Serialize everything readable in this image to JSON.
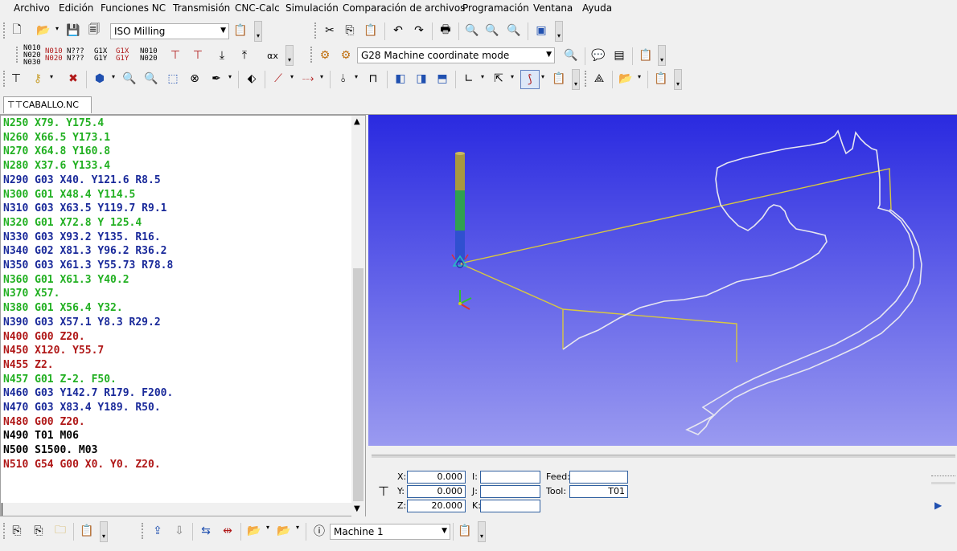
{
  "menu": [
    "Archivo",
    "Edición",
    "Funciones NC",
    "Transmisión",
    "CNC-Calc",
    "Simulación",
    "Comparación de archivos",
    "Programación",
    "Ventana",
    "Ayuda"
  ],
  "toolbar1": {
    "profile_value": "ISO Milling"
  },
  "toolbar2": {
    "mode_value": "G28 Machine coordinate mode",
    "nc_icon_labels": [
      "N010 N020 N030",
      "N010 N020",
      "N??? N???",
      "G1X G1Y",
      "G1X G1Y",
      "N010 N020"
    ]
  },
  "tab": {
    "label": "CABALLO.NC"
  },
  "code_lines": [
    {
      "text": "N250 X79. Y175.4",
      "color": "#22b022"
    },
    {
      "text": "N260 X66.5 Y173.1",
      "color": "#22b022"
    },
    {
      "text": "N270 X64.8 Y160.8",
      "color": "#22b022"
    },
    {
      "text": "N280 X37.6 Y133.4",
      "color": "#22b022"
    },
    {
      "text": "N290 G03 X40. Y121.6 R8.5",
      "color": "#1a2a9a"
    },
    {
      "text": "N300 G01 X48.4 Y114.5",
      "color": "#22b022"
    },
    {
      "text": "N310 G03 X63.5 Y119.7 R9.1",
      "color": "#1a2a9a"
    },
    {
      "text": "N320 G01 X72.8 Y 125.4",
      "color": "#22b022"
    },
    {
      "text": "N330 G03 X93.2 Y135. R16.",
      "color": "#1a2a9a"
    },
    {
      "text": "N340 G02 X81.3 Y96.2 R36.2",
      "color": "#1a2a9a"
    },
    {
      "text": "N350 G03 X61.3 Y55.73 R78.8",
      "color": "#1a2a9a"
    },
    {
      "text": "N360 G01 X61.3 Y40.2",
      "color": "#22b022"
    },
    {
      "text": "N370 X57.",
      "color": "#22b022"
    },
    {
      "text": "N380 G01 X56.4 Y32.",
      "color": "#22b022"
    },
    {
      "text": "N390 G03 X57.1 Y8.3 R29.2",
      "color": "#1a2a9a"
    },
    {
      "text": "N400 G00 Z20.",
      "color": "#b01818"
    },
    {
      "text": "N450 X120. Y55.7",
      "color": "#b01818"
    },
    {
      "text": "N455 Z2.",
      "color": "#b01818"
    },
    {
      "text": "N457 G01 Z-2. F50.",
      "color": "#22b022"
    },
    {
      "text": "N460 G03 Y142.7 R179. F200.",
      "color": "#1a2a9a"
    },
    {
      "text": "N470 G03 X83.4 Y189. R50.",
      "color": "#1a2a9a"
    },
    {
      "text": "N480 G00 Z20.",
      "color": "#b01818"
    },
    {
      "text": "N490 T01 M06",
      "color": "#000000"
    },
    {
      "text": "N500 S1500. M03",
      "color": "#000000"
    },
    {
      "text": "N510 G54 G00 X0. Y0. Z20.",
      "color": "#b01818"
    }
  ],
  "coords": {
    "x_label": "X:",
    "x_value": "0.000",
    "y_label": "Y:",
    "y_value": "0.000",
    "z_label": "Z:",
    "z_value": "20.000",
    "i_label": "I:",
    "j_label": "J:",
    "k_label": "K:",
    "feed_label": "Feed:",
    "feed_value": "",
    "tool_label": "Tool:",
    "tool_value": "T01"
  },
  "bottom": {
    "machine_value": "Machine 1"
  },
  "colors": {
    "viewport_top": "#2a2ae0",
    "viewport_bottom": "#9a9af0",
    "toolpath_rapid": "#d8c840",
    "toolpath_cut": "#e8e8f0"
  }
}
